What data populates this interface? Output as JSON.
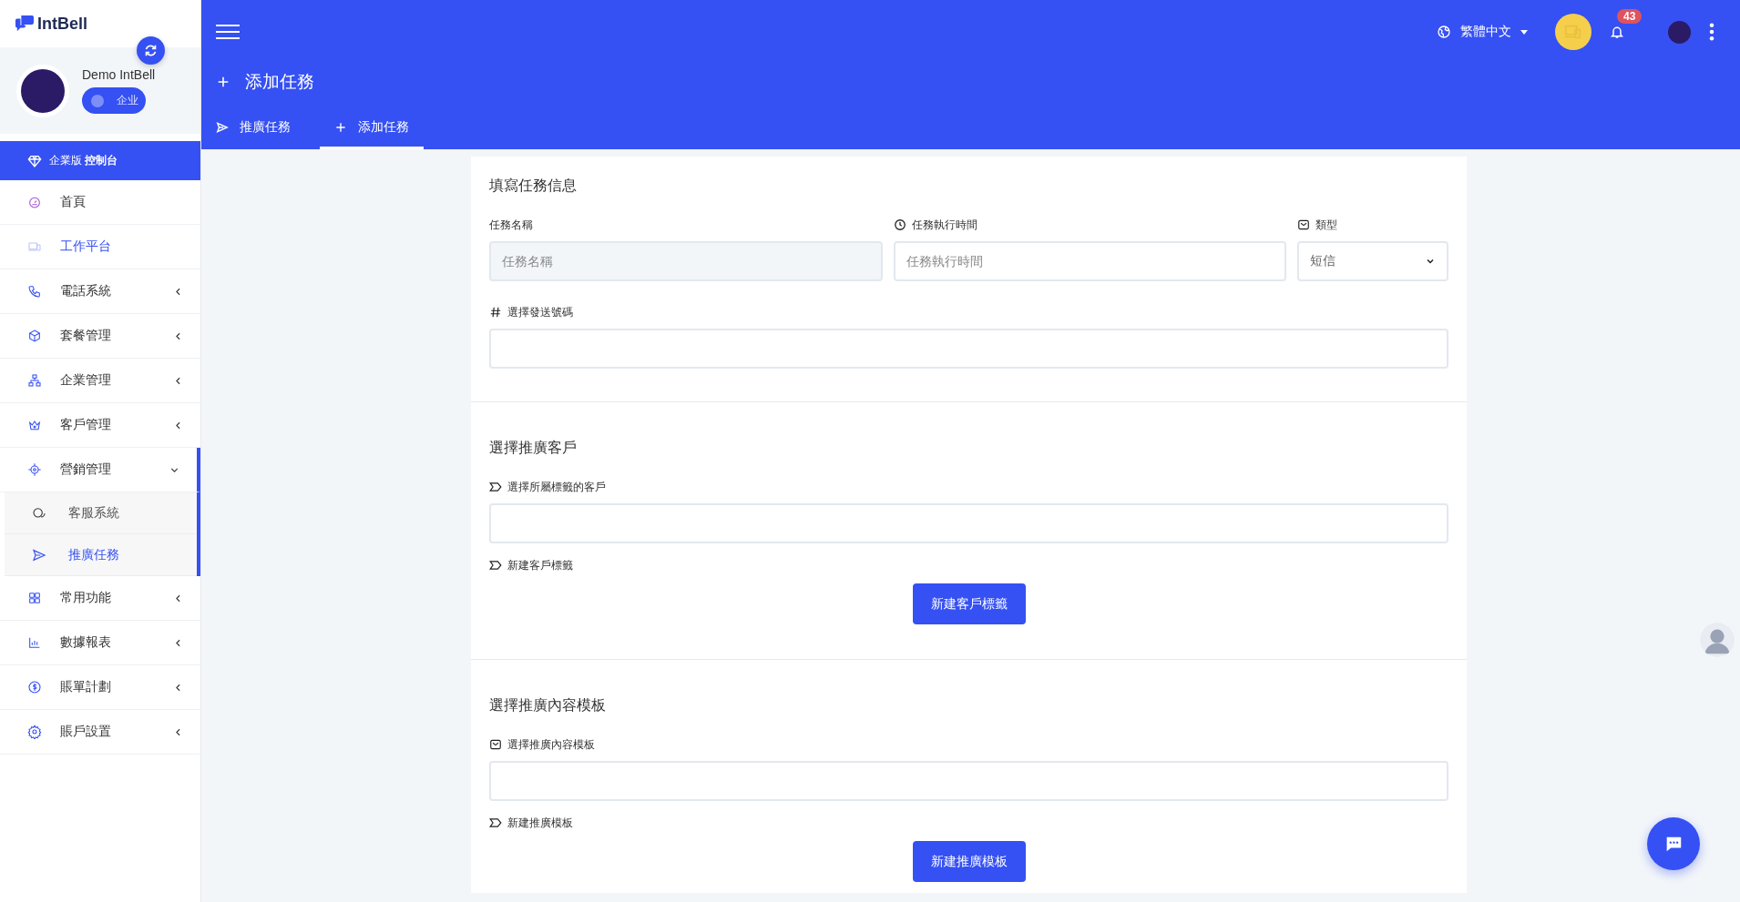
{
  "brand": {
    "name": "IntBell"
  },
  "profile": {
    "name": "Demo IntBell",
    "switch_label": "企业",
    "on": false
  },
  "console_bar": {
    "label": "企業版 **控制台**"
  },
  "sidebar": {
    "items": [
      {
        "label": "首頁",
        "kind": "link",
        "selected": false
      },
      {
        "label": "工作平台",
        "kind": "link",
        "selected": true
      },
      {
        "label": "電話系統",
        "kind": "group",
        "expanded": false,
        "selected": false
      },
      {
        "label": "套餐管理",
        "kind": "group",
        "expanded": false,
        "selected": false
      },
      {
        "label": "企業管理",
        "kind": "group",
        "expanded": false,
        "selected": false
      },
      {
        "label": "客戶管理",
        "kind": "group",
        "expanded": false,
        "selected": false
      },
      {
        "label": "營銷管理",
        "kind": "group",
        "expanded": true,
        "selected": false,
        "children": [
          {
            "label": "客服系統",
            "selected": false
          },
          {
            "label": "推廣任務",
            "selected": true
          }
        ]
      },
      {
        "label": "常用功能",
        "kind": "group",
        "expanded": false,
        "selected": false
      },
      {
        "label": "數據報表",
        "kind": "group",
        "expanded": false,
        "selected": false
      },
      {
        "label": "賬單計劃",
        "kind": "group",
        "expanded": false,
        "selected": false
      },
      {
        "label": "賬戶設置",
        "kind": "group",
        "expanded": false,
        "selected": false
      }
    ]
  },
  "header": {
    "language": "繁體中文",
    "notification_count": "43"
  },
  "page_title": "添加任務",
  "tabs": [
    {
      "label": "推廣任務",
      "selected": false
    },
    {
      "label": "添加任務",
      "selected": true
    }
  ],
  "form": {
    "task_section": {
      "title": "填寫任務信息",
      "name_field": {
        "label": "任務名稱",
        "placeholder": "任務名稱",
        "disabled": true
      },
      "time_field": {
        "label": "任務執行時間",
        "placeholder": "任務執行時間",
        "disabled": false
      },
      "type_field": {
        "label": "類型",
        "value": "短信"
      },
      "number_field": {
        "label": "選擇發送號碼"
      }
    },
    "customer_section": {
      "title": "選擇推廣客戶",
      "tag_field": {
        "label": "選擇所屬標籤的客戶"
      },
      "new_label": "新建客戶標籤",
      "button": "新建客戶標籤"
    },
    "template_section": {
      "title": "選擇推廣內容模板",
      "template_field": {
        "label": "選擇推廣內容模板"
      },
      "new_label": "新建推廣模板",
      "button": "新建推廣模板"
    }
  }
}
